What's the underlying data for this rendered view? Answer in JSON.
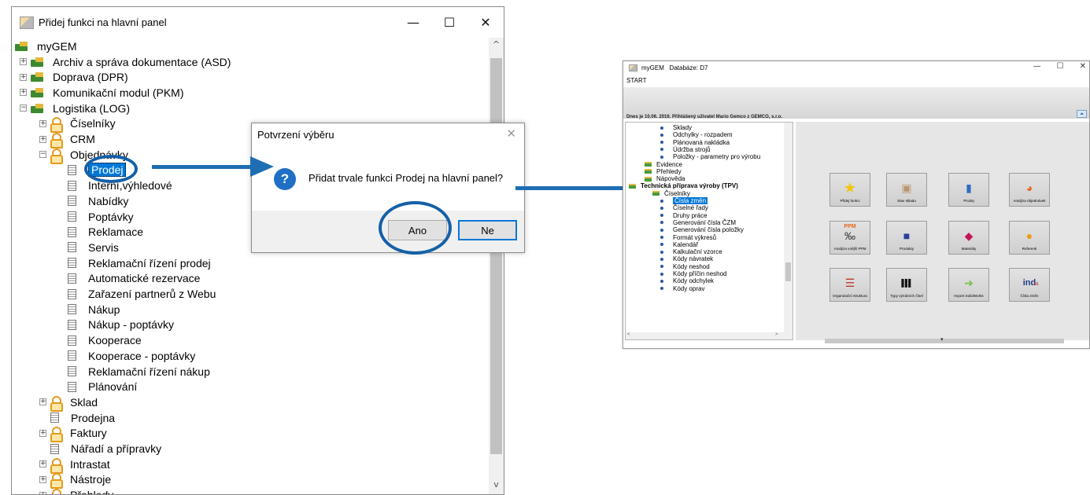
{
  "left_window": {
    "title": "Přidej funkci na hlavní panel",
    "controls": {
      "minimize": "—",
      "maximize": "☐",
      "close": "✕"
    },
    "scroll_up": "^",
    "scroll_down": "v",
    "tree": [
      {
        "label": "myGEM",
        "icon": "module-folder-icon",
        "expander": ""
      },
      {
        "label": "Archiv a správa dokumentace (ASD)",
        "icon": "module-folder-icon",
        "expander": "+"
      },
      {
        "label": "Doprava (DPR)",
        "icon": "module-folder-icon",
        "expander": "+"
      },
      {
        "label": "Komunikační modul (PKM)",
        "icon": "module-folder-icon",
        "expander": "+"
      },
      {
        "label": "Logistika (LOG)",
        "icon": "module-folder-icon",
        "expander": "−"
      },
      {
        "label": "Číselníky",
        "icon": "user-group-icon",
        "expander": "+"
      },
      {
        "label": "CRM",
        "icon": "user-group-icon",
        "expander": "+"
      },
      {
        "label": "Objednávky",
        "icon": "user-group-icon",
        "expander": "−"
      },
      {
        "label": "Prodej",
        "icon": "page-icon",
        "selected": true
      },
      {
        "label": "Interní,výhledové",
        "icon": "page-icon"
      },
      {
        "label": "Nabídky",
        "icon": "page-icon"
      },
      {
        "label": "Poptávky",
        "icon": "page-icon"
      },
      {
        "label": "Reklamace",
        "icon": "page-icon"
      },
      {
        "label": "Servis",
        "icon": "page-icon"
      },
      {
        "label": "Reklamační řízení prodej",
        "icon": "page-icon"
      },
      {
        "label": "Automatické rezervace",
        "icon": "page-icon"
      },
      {
        "label": "Zařazení partnerů z Webu",
        "icon": "page-icon"
      },
      {
        "label": "Nákup",
        "icon": "page-icon"
      },
      {
        "label": "Nákup - poptávky",
        "icon": "page-icon"
      },
      {
        "label": "Kooperace",
        "icon": "page-icon"
      },
      {
        "label": "Kooperace - poptávky",
        "icon": "page-icon"
      },
      {
        "label": "Reklamační řízení nákup",
        "icon": "page-icon"
      },
      {
        "label": "Plánování",
        "icon": "page-icon"
      },
      {
        "label": "Sklad",
        "icon": "user-group-icon",
        "expander": "+"
      },
      {
        "label": "Prodejna",
        "icon": "page-icon"
      },
      {
        "label": "Faktury",
        "icon": "user-group-icon",
        "expander": "+"
      },
      {
        "label": "Nářadí a přípravky",
        "icon": "page-icon"
      },
      {
        "label": "Intrastat",
        "icon": "user-group-icon",
        "expander": "+"
      },
      {
        "label": "Nástroje",
        "icon": "user-group-icon",
        "expander": "+"
      },
      {
        "label": "Přehledy",
        "icon": "user-group-icon",
        "expander": "+"
      }
    ]
  },
  "dialog": {
    "title": "Potvrzení výběru",
    "close": "✕",
    "icon": "question-icon",
    "icon_glyph": "?",
    "message": "Přidat trvale funkci Prodej na hlavní panel?",
    "yes_label": "Ano",
    "no_label": "Ne"
  },
  "right_window": {
    "title": "myGEM   Databáze: D7",
    "menu_start": "START",
    "controls": {
      "minimize": "—",
      "maximize": "☐",
      "close": "✕"
    },
    "info_line": "Dnes je 10.06. 2016.  Přihlášený uživatel Mario Gemco z GEMCO, s.r.o.",
    "scroll_up": "⏶",
    "hscroll_left": "<",
    "hscroll_right": ">",
    "tree": [
      {
        "label": "Sklady",
        "type": "item"
      },
      {
        "label": "Odchylky - rozpadem",
        "type": "item"
      },
      {
        "label": "Plánovaná nakládka",
        "type": "item"
      },
      {
        "label": "Údržba strojů",
        "type": "item"
      },
      {
        "label": "Položky - parametry pro výrobu",
        "type": "item"
      },
      {
        "label": "Evidence",
        "type": "folder"
      },
      {
        "label": "Přehledy",
        "type": "folder"
      },
      {
        "label": "Nápověda",
        "type": "folder"
      },
      {
        "label": "Technická příprava výroby (TPV)",
        "type": "module"
      },
      {
        "label": "Číselníky",
        "type": "folder"
      },
      {
        "label": "Čísla změn",
        "type": "item",
        "selected": true
      },
      {
        "label": "Číselné řady",
        "type": "item"
      },
      {
        "label": "Druhy práce",
        "type": "item"
      },
      {
        "label": "Generování čísla ČZM",
        "type": "item"
      },
      {
        "label": "Generování čísla položky",
        "type": "item"
      },
      {
        "label": "Formát výkresů",
        "type": "item"
      },
      {
        "label": "Kalendář",
        "type": "item"
      },
      {
        "label": "Kalkulační vzorce",
        "type": "item"
      },
      {
        "label": "Kódy návratek",
        "type": "item"
      },
      {
        "label": "Kódy neshod",
        "type": "item"
      },
      {
        "label": "Kódy příčin neshod",
        "type": "item"
      },
      {
        "label": "Kódy odchylek",
        "type": "item"
      },
      {
        "label": "Kódy oprav",
        "type": "item"
      }
    ],
    "tiles": [
      {
        "label": "Přidej funkci",
        "icon": "star-icon",
        "glyph": "★",
        "color": "#f2c500"
      },
      {
        "label": "Stav skladu",
        "icon": "warehouse-box-icon",
        "glyph": "▣",
        "color": "#b9956a"
      },
      {
        "label": "Prodej",
        "icon": "book-icon",
        "glyph": "▮",
        "color": "#2b6fc2"
      },
      {
        "label": "Analýza objednávek",
        "icon": "pie-chart-icon",
        "glyph": "◕",
        "color": "#e8651a"
      },
      {
        "label": "Analýza vnější PPM",
        "icon": "ppm-icon",
        "glyph": "‰",
        "color": "#333333"
      },
      {
        "label": "Produkty",
        "icon": "cube-icon",
        "glyph": "■",
        "color": "#2a3f9c"
      },
      {
        "label": "Materiály",
        "icon": "shapes-icon",
        "glyph": "◆",
        "color": "#c2185b"
      },
      {
        "label": "Referenti",
        "icon": "person-icon",
        "glyph": "●",
        "color": "#f19a16"
      },
      {
        "label": "Organizační struktura",
        "icon": "org-chart-icon",
        "glyph": "☰",
        "color": "#c0392b"
      },
      {
        "label": "Typy výrobních čísel",
        "icon": "barcode-icon",
        "glyph": "▌▌▌",
        "color": "#111111"
      },
      {
        "label": "Import SolidWorks",
        "icon": "arrow-right-icon",
        "glyph": "➜",
        "color": "#7ac142"
      },
      {
        "label": "Čísla změn",
        "icon": "index-icon",
        "glyph": "ind",
        "color": "#1e3a8a"
      }
    ],
    "ppm_label": "PPM",
    "ind_sub": "01",
    "bottom_marker": "▾"
  }
}
